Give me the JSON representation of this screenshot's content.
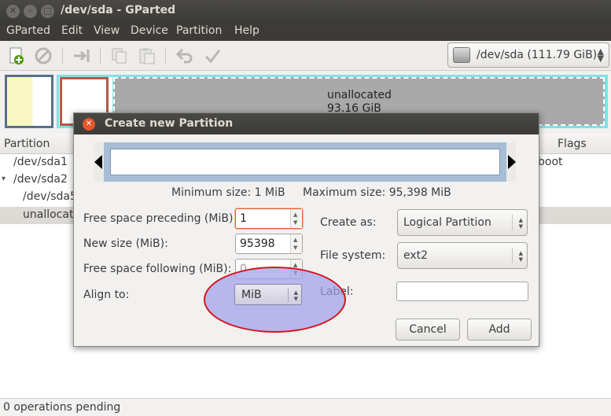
{
  "window": {
    "title": "/dev/sda - GParted"
  },
  "menubar": {
    "items": [
      "GParted",
      "Edit",
      "View",
      "Device",
      "Partition",
      "Help"
    ]
  },
  "toolbar": {
    "icons": [
      "new-partition-icon",
      "delete-icon",
      "resize-move-icon",
      "copy-icon",
      "paste-icon",
      "undo-icon",
      "apply-icon"
    ],
    "device_selector": "/dev/sda  (111.79 GiB)"
  },
  "disk_graphic": {
    "unallocated_label": "unallocated",
    "unallocated_size": "93.16 GiB"
  },
  "partition_list": {
    "columns": {
      "partition": "Partition",
      "flags": "Flags"
    },
    "rows": [
      {
        "name": "/dev/sda1",
        "flags": "boot",
        "expander": ""
      },
      {
        "name": "/dev/sda2",
        "flags": "",
        "expander": "▾"
      },
      {
        "name": "/dev/sda5",
        "flags": "",
        "expander": ""
      },
      {
        "name": "unallocated",
        "flags": "",
        "expander": ""
      }
    ]
  },
  "statusbar": {
    "text": "0 operations pending"
  },
  "dialog": {
    "title": "Create new Partition",
    "min_size": "Minimum size: 1 MiB",
    "max_size": "Maximum size: 95,398 MiB",
    "fields": {
      "free_preceding": {
        "label": "Free space preceding (MiB):",
        "value": "1"
      },
      "new_size": {
        "label": "New size (MiB):",
        "value": "95398"
      },
      "free_following": {
        "label": "Free space following (MiB):",
        "value": "0"
      },
      "align_to": {
        "label": "Align to:",
        "value": "MiB"
      },
      "create_as": {
        "label": "Create as:",
        "value": "Logical Partition"
      },
      "file_system": {
        "label": "File system:",
        "value": "ext2"
      },
      "label": {
        "label": "Label:",
        "value": ""
      }
    },
    "buttons": {
      "cancel": "Cancel",
      "add": "Add"
    }
  },
  "annotation": {
    "color": "#d9141c",
    "fill": "#a0a0eb"
  }
}
